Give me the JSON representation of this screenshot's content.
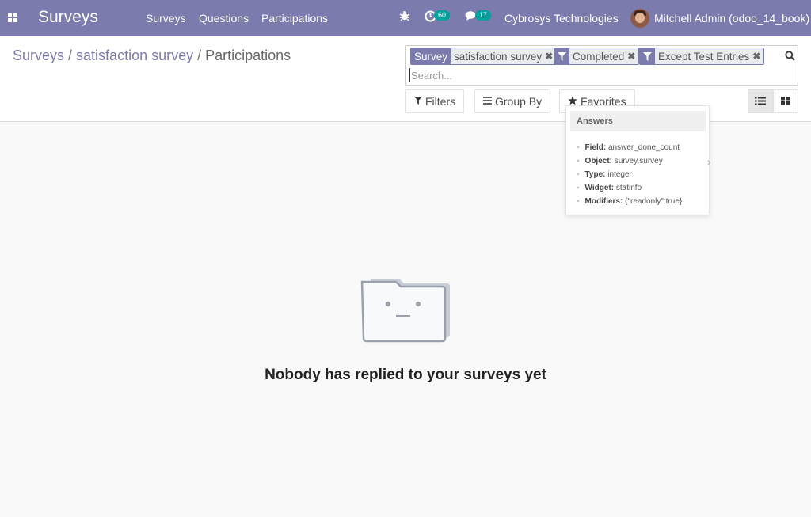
{
  "navbar": {
    "brand": "Surveys",
    "menu": [
      "Surveys",
      "Questions",
      "Participations"
    ],
    "activity_count": "60",
    "message_count": "17",
    "company": "Cybrosys Technologies",
    "user": "Mitchell Admin (odoo_14_book)",
    "accent_color": "#7c7bad",
    "badge_color": "#00a09d",
    "icons": [
      "apps-icon",
      "bug-icon",
      "activity-clock-icon",
      "messages-icon"
    ]
  },
  "breadcrumb": {
    "items": [
      "Surveys",
      "satisfaction survey"
    ],
    "separator": "/",
    "active": "Participations"
  },
  "search": {
    "facets": [
      {
        "key": "Survey",
        "value": "satisfaction survey"
      },
      {
        "key_icon": "filter-icon",
        "value": "Completed"
      },
      {
        "key_icon": "filter-icon",
        "value": "Except Test Entries"
      }
    ],
    "placeholder": "Search..."
  },
  "buttons": {
    "filters": "Filters",
    "group_by": "Group By",
    "favorites": "Favorites"
  },
  "views": {
    "active": "list",
    "available": [
      "list",
      "kanban"
    ]
  },
  "tooltip": {
    "title": "Answers",
    "rows": [
      {
        "label": "Field:",
        "value": "answer_done_count"
      },
      {
        "label": "Object:",
        "value": "survey.survey"
      },
      {
        "label": "Type:",
        "value": "integer"
      },
      {
        "label": "Widget:",
        "value": "statinfo"
      },
      {
        "label": "Modifiers:",
        "value": "{\"readonly\":true}"
      }
    ]
  },
  "empty_state": {
    "message": "Nobody has replied to your surveys yet"
  }
}
